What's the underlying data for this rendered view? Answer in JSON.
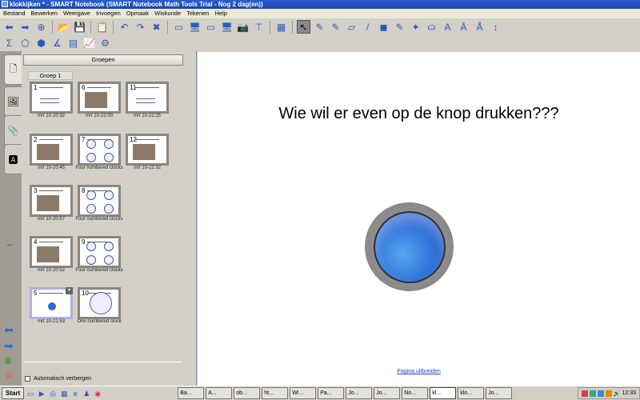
{
  "window": {
    "title": "klokkijken * - SMART Notebook (SMART Notebook Math Tools Trial - Nog 2 dag(en))"
  },
  "menu": [
    "Bestand",
    "Bewerken",
    "Weergave",
    "Invoegen",
    "Opmaak",
    "Wiskunde",
    "Tekenen",
    "Help"
  ],
  "toolbar1": [
    {
      "name": "back-icon",
      "glyph": "⬅"
    },
    {
      "name": "forward-icon",
      "glyph": "➡"
    },
    {
      "name": "add-page-icon",
      "glyph": "⊕"
    },
    {
      "sep": true
    },
    {
      "name": "open-folder-icon",
      "glyph": "📂"
    },
    {
      "name": "save-icon",
      "glyph": "💾"
    },
    {
      "sep": true
    },
    {
      "name": "paste-icon",
      "glyph": "📋"
    },
    {
      "sep": true
    },
    {
      "name": "undo-icon",
      "glyph": "↶"
    },
    {
      "name": "redo-icon",
      "glyph": "↷"
    },
    {
      "name": "delete-icon",
      "glyph": "✖"
    },
    {
      "sep": true
    },
    {
      "name": "screen-shade-icon",
      "glyph": "▭"
    },
    {
      "name": "full-screen-icon",
      "glyph": "🖥"
    },
    {
      "name": "transparent-bg-icon",
      "glyph": "▭"
    },
    {
      "name": "dual-page-icon",
      "glyph": "🖥"
    },
    {
      "name": "screen-capture-icon",
      "glyph": "📷"
    },
    {
      "name": "document-camera-icon",
      "glyph": "⊤"
    },
    {
      "sep": true
    },
    {
      "name": "table-icon",
      "glyph": "▦"
    },
    {
      "sep": true
    },
    {
      "name": "select-icon",
      "glyph": "↖",
      "active": true
    },
    {
      "name": "pen-icon",
      "glyph": "✎"
    },
    {
      "name": "creative-pen-icon",
      "glyph": "✎"
    },
    {
      "name": "eraser-icon",
      "glyph": "▱"
    },
    {
      "name": "line-icon",
      "glyph": "/"
    },
    {
      "name": "shapes-icon",
      "glyph": "◼"
    },
    {
      "name": "shape-pen-icon",
      "glyph": "✎"
    },
    {
      "name": "magic-pen-icon",
      "glyph": "✦"
    },
    {
      "name": "fill-icon",
      "glyph": "⛀"
    },
    {
      "name": "text-icon",
      "glyph": "A"
    },
    {
      "name": "handwriting-icon",
      "glyph": "Ā"
    },
    {
      "name": "measurement-tools-icon",
      "glyph": "Å"
    },
    {
      "name": "more-tools-icon",
      "glyph": "↕"
    }
  ],
  "toolbar2": [
    {
      "name": "sigma-icon",
      "glyph": "Σ"
    },
    {
      "name": "shape-icon",
      "glyph": "⬠"
    },
    {
      "name": "3d-shape-icon",
      "glyph": "⬢"
    },
    {
      "name": "compass-icon",
      "glyph": "∡"
    },
    {
      "name": "table-sum-icon",
      "glyph": "▤"
    },
    {
      "name": "graph-icon",
      "glyph": "📈"
    },
    {
      "name": "math-tools-icon",
      "glyph": "⚙"
    }
  ],
  "panel": {
    "groups_button": "Groepen",
    "group_label": "Groep 1",
    "auto_hide": "Automatisch verbergen"
  },
  "pages": [
    {
      "num": "1",
      "label": "mrt 10-20:32",
      "kind": "plain"
    },
    {
      "num": "6",
      "label": "mrt 10-22:00",
      "kind": "photo"
    },
    {
      "num": "11",
      "label": "mrt 10-22:25",
      "kind": "plain"
    },
    {
      "num": "2",
      "label": "mrt 10-20:45",
      "kind": "photo"
    },
    {
      "num": "7",
      "label": "Four numbered clocks",
      "kind": "clocks4"
    },
    {
      "num": "12",
      "label": "mrt 10-22:32",
      "kind": "photo"
    },
    {
      "num": "3",
      "label": "mrt 10-20:57",
      "kind": "photo"
    },
    {
      "num": "8",
      "label": "Four numbered clocks",
      "kind": "clocks4"
    },
    {
      "num": "4",
      "label": "mrt 10-20:52",
      "kind": "photo"
    },
    {
      "num": "9",
      "label": "Four numbered clocks",
      "kind": "clocks4"
    },
    {
      "num": "5",
      "label": "mrt 10-21:53",
      "kind": "button",
      "selected": true
    },
    {
      "num": "10",
      "label": "One numbered clock",
      "kind": "clock1"
    }
  ],
  "canvas": {
    "heading": "Wie wil er even op de knop drukken???",
    "extend_link": "Pagina uitbreiden",
    "button_color": "#2a6ad6"
  },
  "taskbar": {
    "start": "Start",
    "tasks": [
      "Ba...",
      "A...",
      "ob...",
      "ht...",
      "Wi...",
      "Pa...",
      "Jo...",
      "Jo...",
      "No...",
      "kl...",
      "klo...",
      "Jo..."
    ],
    "active_task": 9,
    "clock": "12:33"
  }
}
